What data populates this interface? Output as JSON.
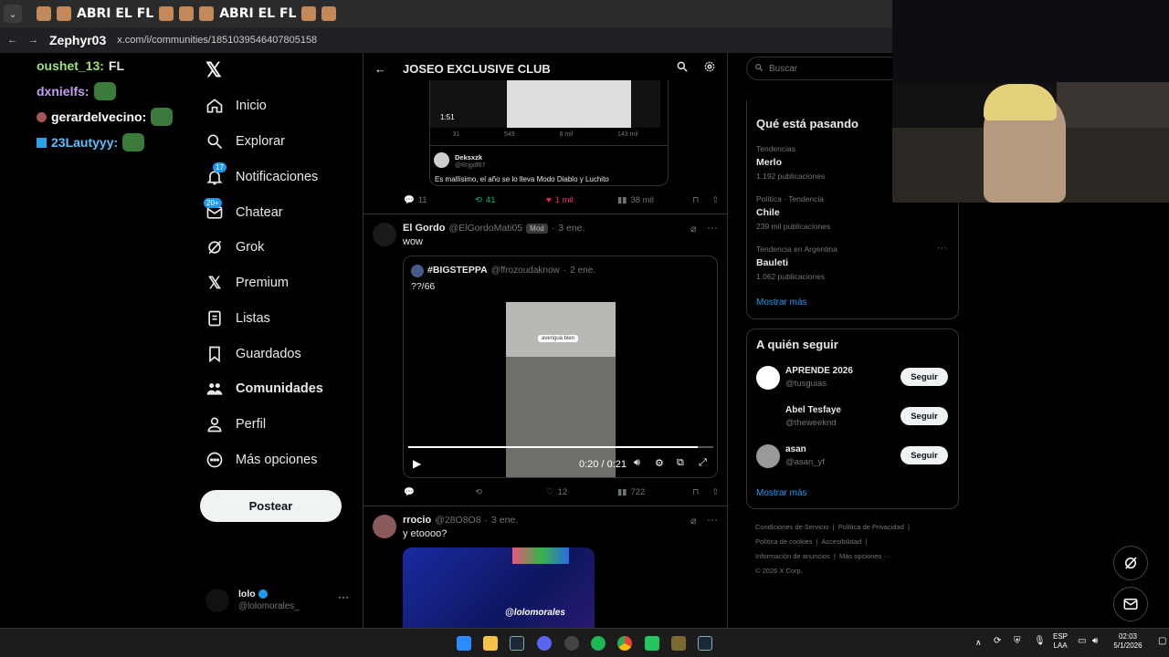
{
  "browser": {
    "banner_text_1": "ABRI EL FL",
    "banner_text_2": "ABRI EL FL",
    "overlay_name": "Zephyr03",
    "url": "x.com/i/communities/1851039546407805158"
  },
  "chat": {
    "lines": [
      {
        "user": "oushet_13:",
        "message": "FL",
        "color": "#9be47a"
      },
      {
        "user": "dxnielfs:",
        "message": "",
        "color": "#c69cf5"
      },
      {
        "user": "gerardelvecino:",
        "message": "",
        "color": "#ffffff"
      },
      {
        "user": "23Lautyyy:",
        "message": "",
        "color": "#5bc0ff"
      }
    ]
  },
  "sidebar": {
    "items": [
      {
        "label": "Inicio",
        "icon": "home-icon"
      },
      {
        "label": "Explorar",
        "icon": "search-icon"
      },
      {
        "label": "Notificaciones",
        "icon": "bell-icon",
        "badge": "17"
      },
      {
        "label": "Chatear",
        "icon": "mail-icon",
        "badge": "20+"
      },
      {
        "label": "Grok",
        "icon": "grok-icon"
      },
      {
        "label": "Premium",
        "icon": "x-icon"
      },
      {
        "label": "Listas",
        "icon": "list-icon"
      },
      {
        "label": "Guardados",
        "icon": "bookmark-icon"
      },
      {
        "label": "Comunidades",
        "icon": "communities-icon"
      },
      {
        "label": "Perfil",
        "icon": "person-icon"
      },
      {
        "label": "Más opciones",
        "icon": "more-circle-icon"
      }
    ],
    "post_button": "Postear",
    "account": {
      "name": "lolo",
      "handle": "@lolomorales_"
    }
  },
  "header": {
    "title": "JOSEO EXCLUSIVE CLUB"
  },
  "post1": {
    "video_time": "1:51",
    "inner_stats": [
      "31",
      "549",
      "8 mil",
      "143 mil"
    ],
    "reply": {
      "name": "Deksxzk",
      "handle": "@Rrjgdf67",
      "text": "Es mallísimo, el año se lo lleva Modo Diablo y Luchito"
    },
    "stats": {
      "replies": "11",
      "reposts": "41",
      "likes": "1 mil",
      "views": "38 mil"
    }
  },
  "post2": {
    "name": "El Gordo",
    "handle": "@ElGordoMati05",
    "role": "Mod",
    "time": "3 ene.",
    "text": "wow",
    "quote": {
      "name": "#BIGSTEPPA",
      "handle": "@ffrozoudaknow",
      "time": "2 ene.",
      "text": "??/66"
    },
    "video_overlay": "averiguá bien",
    "video_time": "0:20 / 0:21",
    "progress": 0.95,
    "stats": {
      "replies": "",
      "reposts": "",
      "likes": "12",
      "views": "722"
    }
  },
  "post3": {
    "name": "rrocio",
    "handle": "@28O8O8",
    "time": "3 ene.",
    "text": "y etoooo?",
    "image_caption": "@lolomorales"
  },
  "right": {
    "search_placeholder": "Buscar",
    "trending_title": "Qué está pasando",
    "trends": [
      {
        "category": "Tendencias",
        "name": "Merlo",
        "count": "1.192 publicaciones"
      },
      {
        "category": "Política · Tendencia",
        "name": "Chile",
        "count": "239 mil publicaciones"
      },
      {
        "category": "Tendencia en Argentina",
        "name": "Bauleti",
        "count": "1.062 publicaciones"
      }
    ],
    "show_more": "Mostrar más",
    "follow_title": "A quién seguir",
    "follow": [
      {
        "name": "APRENDE 2026",
        "handle": "@tusguias",
        "button": "Seguir"
      },
      {
        "name": "Abel Tesfaye",
        "handle": "@theweeknd",
        "button": "Seguir"
      },
      {
        "name": "asan",
        "handle": "@asan_yf",
        "button": "Seguir"
      }
    ],
    "show_more_2": "Mostrar más",
    "footer": {
      "l1": "Condiciones de Servicio",
      "l2": "Política de Privacidad",
      "l3": "Política de cookies",
      "l4": "Accesibilidad",
      "l5": "Información de anuncios",
      "l6": "Más opciones ···",
      "copy": "© 2026 X Corp."
    }
  },
  "taskbar": {
    "lang1": "ESP",
    "lang2": "LAA",
    "time": "02:03",
    "date": "5/1/2026"
  }
}
